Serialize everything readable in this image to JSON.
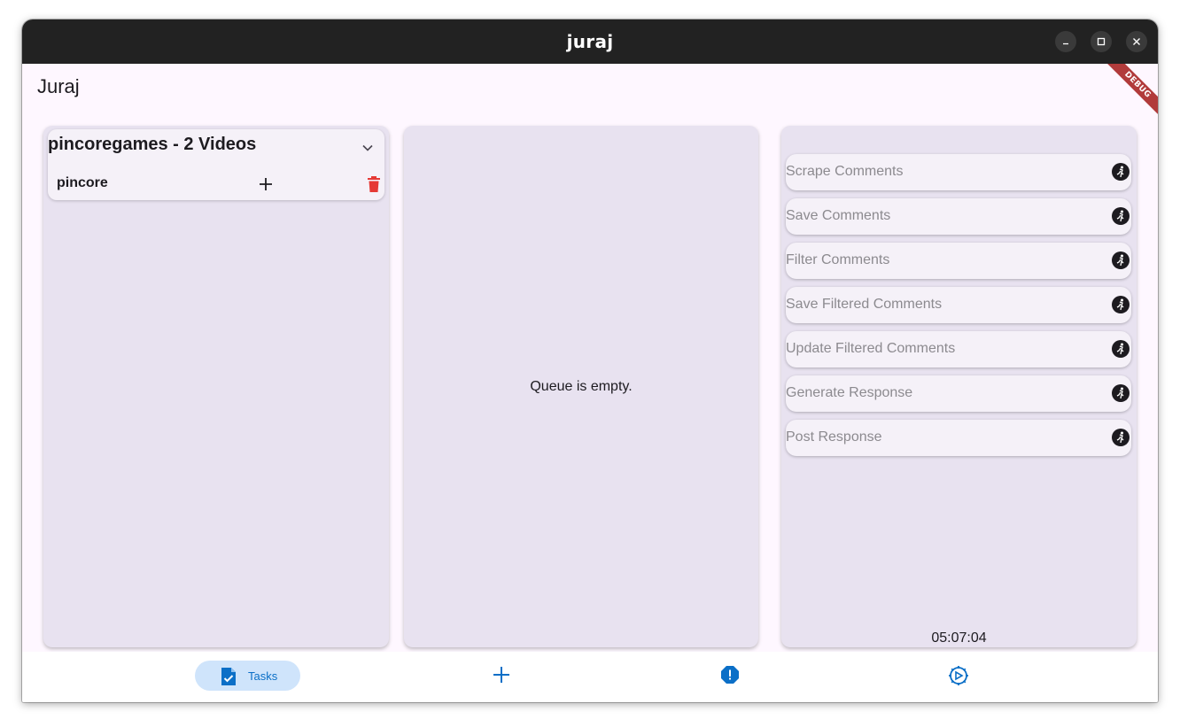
{
  "window": {
    "title": "juraj",
    "controls": [
      "minimize-icon",
      "maximize-icon",
      "close-icon"
    ]
  },
  "appbar": {
    "title": "Juraj",
    "debug_banner": "DEBUG"
  },
  "channels_panel": {
    "channels": [
      {
        "title": "pincoregames - 2 Videos",
        "expanded": true,
        "videos": [
          {
            "name": "pincore",
            "add_icon": "plus-icon",
            "delete_icon": "trash-icon"
          }
        ]
      }
    ]
  },
  "queue_panel": {
    "empty_text": "Queue is empty."
  },
  "steps_panel": {
    "steps": [
      {
        "label": "Scrape Comments",
        "icon": "run-icon"
      },
      {
        "label": "Save Comments",
        "icon": "run-icon"
      },
      {
        "label": "Filter Comments",
        "icon": "run-icon"
      },
      {
        "label": "Save Filtered Comments",
        "icon": "run-icon"
      },
      {
        "label": "Update Filtered Comments",
        "icon": "run-icon"
      },
      {
        "label": "Generate Response",
        "icon": "run-icon"
      },
      {
        "label": "Post Response",
        "icon": "run-icon"
      }
    ],
    "clock": "05:07:04"
  },
  "navbar": {
    "items": [
      {
        "label": "Tasks",
        "icon": "task-file-icon",
        "selected": true
      },
      {
        "label": "",
        "icon": "plus-icon",
        "selected": false
      },
      {
        "label": "",
        "icon": "alert-octagon-icon",
        "selected": false
      },
      {
        "label": "",
        "icon": "settings-gear-icon",
        "selected": false
      }
    ]
  },
  "colors": {
    "accent": "#0b6fc7",
    "nav_selected_bg": "#cfe4fb",
    "panel_bg": "#e8e2f0",
    "delete": "#e53935",
    "titlebar": "#222222"
  }
}
